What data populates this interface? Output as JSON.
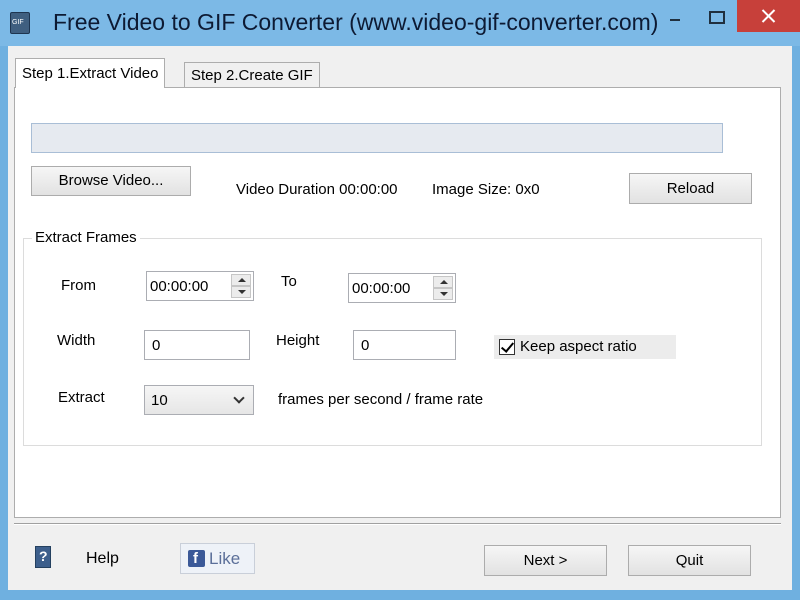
{
  "window": {
    "title": "Free Video to GIF Converter (www.video-gif-converter.com)",
    "icon": "gif-app-icon",
    "controls": [
      "minimize-icon",
      "maximize-icon",
      "close-icon"
    ]
  },
  "tabs": [
    {
      "label": "Step 1.Extract Video",
      "active": true
    },
    {
      "label": "Step 2.Create GIF",
      "active": false
    }
  ],
  "extract": {
    "path_value": "",
    "browse_label": "Browse Video...",
    "duration_text": "Video Duration 00:00:00",
    "image_size_text": "Image Size: 0x0",
    "reload_label": "Reload",
    "group_title": "Extract Frames",
    "from_label": "From",
    "from_value": "00:00:00",
    "to_label": "To",
    "to_value": "00:00:00",
    "width_label": "Width",
    "width_value": "0",
    "height_label": "Height",
    "height_value": "0",
    "keep_aspect_label": "Keep aspect ratio",
    "keep_aspect_checked": true,
    "extract_label": "Extract",
    "fps_value": "10",
    "fps_suffix": "frames per second / frame rate"
  },
  "footer": {
    "help_label": "Help",
    "help_icon": "help-book-icon",
    "like_label": "Like",
    "like_icon": "facebook-icon",
    "next_label": "Next >",
    "quit_label": "Quit"
  },
  "colors": {
    "titlebar": "#7cb9e6",
    "close_button": "#c7403a",
    "dialog_bg": "#f0f0f0",
    "facebook": "#3b5998"
  }
}
